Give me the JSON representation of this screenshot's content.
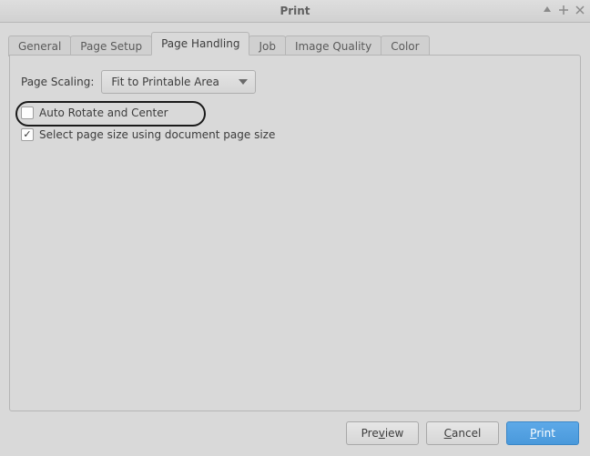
{
  "window": {
    "title": "Print"
  },
  "tabs": {
    "general": "General",
    "page_setup": "Page Setup",
    "page_handling": "Page Handling",
    "job": "Job",
    "image_quality": "Image Quality",
    "color": "Color",
    "active": "page_handling"
  },
  "page_handling": {
    "scaling_label": "Page Scaling:",
    "scaling_value": "Fit to Printable Area",
    "auto_rotate_label": "Auto Rotate and Center",
    "auto_rotate_checked": false,
    "select_size_label": "Select page size using document page size",
    "select_size_checked": true
  },
  "buttons": {
    "preview_full": "Preview",
    "preview_pre": "Pre",
    "preview_m": "v",
    "preview_post": "iew",
    "cancel_full": "Cancel",
    "cancel_m": "C",
    "cancel_post": "ancel",
    "print_full": "Print",
    "print_m": "P",
    "print_post": "rint"
  }
}
